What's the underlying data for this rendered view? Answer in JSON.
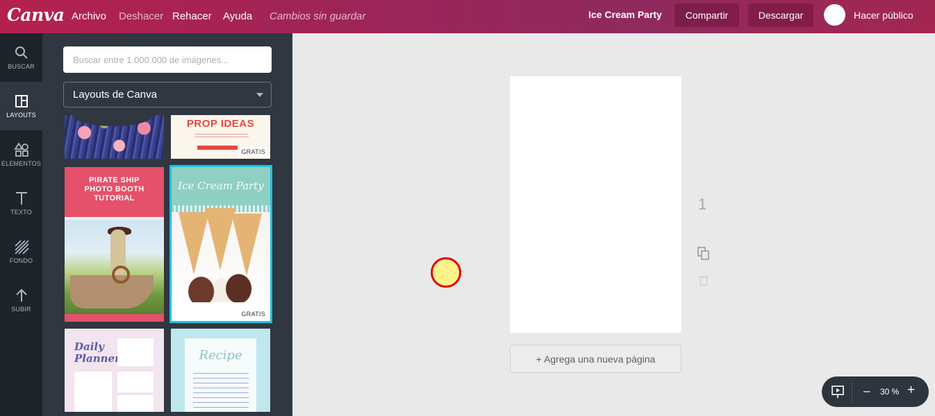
{
  "app": {
    "logo": "Canva",
    "menu": [
      "Archivo",
      "Deshacer",
      "Rehacer",
      "Ayuda"
    ],
    "status": "Cambios sin guardar",
    "doc_title": "Ice Cream Party",
    "share_label": "Compartir",
    "download_label": "Descargar",
    "public_label": "Hacer público",
    "brand_color": "#9c2559"
  },
  "rail": {
    "items": [
      {
        "label": "BUSCAR",
        "icon": "search-icon"
      },
      {
        "label": "LAYOUTS",
        "icon": "layout-icon"
      },
      {
        "label": "ELEMENTOS",
        "icon": "shapes-icon"
      },
      {
        "label": "TEXTO",
        "icon": "text-icon"
      },
      {
        "label": "FONDO",
        "icon": "background-icon"
      },
      {
        "label": "SUBIR",
        "icon": "upload-icon"
      }
    ],
    "active": "LAYOUTS"
  },
  "panel": {
    "search_placeholder": "Buscar entre 1.000.000 de imágenes...",
    "select_value": "Layouts de Canva",
    "thumbs": {
      "prop_title": "PROP IDEAS",
      "pirate_title": "PIRATE SHIP\nPHOTO BOOTH\nTUTORIAL",
      "ice_title": "Ice Cream Party",
      "planner_title": "Daily\nPlanner",
      "recipe_title": "Recipe",
      "gratis": "GRATIS"
    }
  },
  "canvas": {
    "page_number": "1",
    "add_page_label": "+ Agrega una nueva página"
  },
  "zoom": {
    "minus": "–",
    "level": "30 %",
    "plus": "+"
  }
}
